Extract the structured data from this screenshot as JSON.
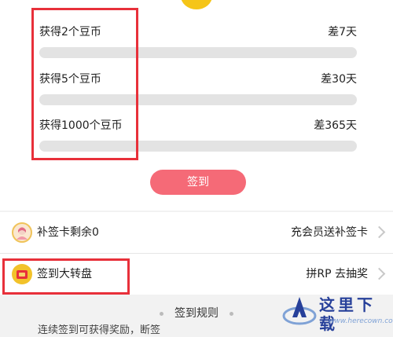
{
  "rewards": [
    {
      "label": "获得2个豆币",
      "remaining": "差7天",
      "progress": 0
    },
    {
      "label": "获得5个豆币",
      "remaining": "差30天",
      "progress": 0
    },
    {
      "label": "获得1000个豆币",
      "remaining": "差365天",
      "progress": 0
    }
  ],
  "signin_button": "签到",
  "makeup_card": {
    "label": "补签卡剩余0",
    "action": "充会员送补签卡",
    "icon": "avatar-icon"
  },
  "wheel": {
    "label": "签到大转盘",
    "action": "拼RP 去抽奖",
    "icon": "prize-bag-icon"
  },
  "rules_title": "签到规则",
  "rules_first_line": "连续签到可获得奖励，断签",
  "watermark": {
    "text": "这里下载",
    "url": "www.herecown.com"
  },
  "colors": {
    "accent": "#f56a77",
    "highlight": "#e8303a",
    "coin": "#f5c518"
  }
}
